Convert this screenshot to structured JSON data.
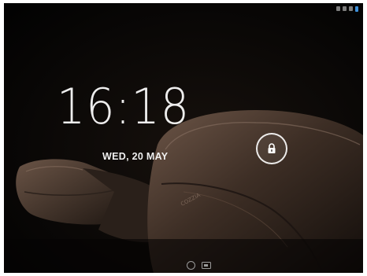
{
  "lockscreen": {
    "time": "16:18",
    "date": "WED, 20 MAY"
  },
  "wallpaper": {
    "brand_text": "COZZIA"
  },
  "status_bar": {
    "icons": [
      "location-icon",
      "sync-icon",
      "wifi-icon",
      "battery-icon"
    ]
  },
  "nav_bar": {
    "icons": [
      "home-icon",
      "camera-icon"
    ]
  },
  "colors": {
    "background": "#050403",
    "chair_leather": "#4a382d",
    "battery_accent": "#3d8fd8",
    "text": "#ffffff"
  }
}
